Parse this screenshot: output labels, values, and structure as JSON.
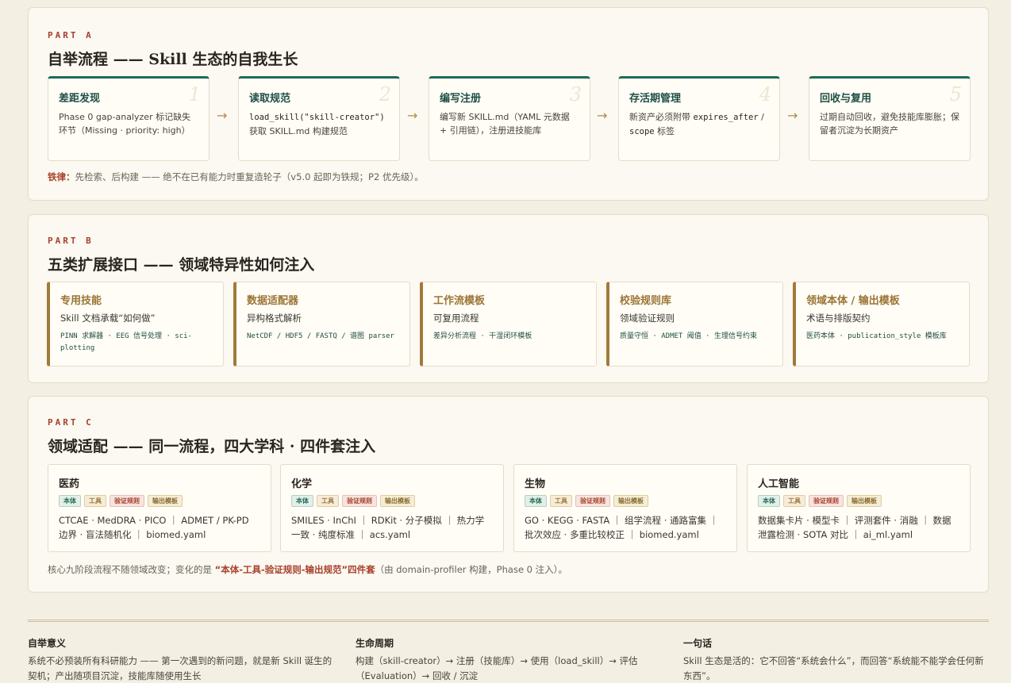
{
  "partA": {
    "label": "PART A",
    "title": "自举流程 —— Skill 生态的自我生长",
    "steps": [
      {
        "num": "1",
        "title": "差距发现",
        "desc": "Phase 0 gap-analyzer 标记缺失环节（Missing · priority: high）"
      },
      {
        "num": "2",
        "title": "读取规范",
        "code": "load_skill(\"skill-creator\")",
        "desc": " 获取 SKILL.md 构建规范"
      },
      {
        "num": "3",
        "title": "编写注册",
        "desc": "编写新 SKILL.md（YAML 元数据 + 引用链），注册进技能库"
      },
      {
        "num": "4",
        "title": "存活期管理",
        "desc1": "新资产必须附带 ",
        "code1": "expires_after",
        "desc2": " / ",
        "code2": "scope",
        "desc3": " 标签"
      },
      {
        "num": "5",
        "title": "回收与复用",
        "desc": "过期自动回收，避免技能库膨胀；保留者沉淀为长期资产"
      }
    ],
    "arrow": "→",
    "rule_label": "铁律：",
    "rule_text": "先检索、后构建 —— 绝不在已有能力时重复造轮子（v5.0 起即为铁规；P2 优先级）。"
  },
  "partB": {
    "label": "PART B",
    "title": "五类扩展接口 —— 领域特异性如何注入",
    "interfaces": [
      {
        "title": "专用技能",
        "sub": "Skill 文档承载“如何做”",
        "ex": "PINN 求解器 · EEG 信号处理 · sci-plotting"
      },
      {
        "title": "数据适配器",
        "sub": "异构格式解析",
        "ex": "NetCDF / HDF5 / FASTQ / 谱图 parser"
      },
      {
        "title": "工作流模板",
        "sub": "可复用流程",
        "ex": "差异分析流程 · 干湿闭环模板"
      },
      {
        "title": "校验规则库",
        "sub": "领域验证规则",
        "ex": "质量守恒 · ADMET 阈值 · 生理信号约束"
      },
      {
        "title": "领域本体 / 输出模板",
        "sub": "术语与排版契约",
        "ex": "医药本体 · publication_style 模板库"
      }
    ]
  },
  "partC": {
    "label": "PART C",
    "title": "领域适配 —— 同一流程，四大学科 · 四件套注入",
    "tags": [
      "本体",
      "工具",
      "验证规则",
      "输出模板"
    ],
    "domains": [
      {
        "title": "医药",
        "desc": "CTCAE · MedDRA · PICO ｜ ADMET / PK-PD 边界 · 盲法随机化 ｜ biomed.yaml"
      },
      {
        "title": "化学",
        "desc": "SMILES · InChI ｜ RDKit · 分子模拟 ｜ 热力学一致 · 纯度标准 ｜ acs.yaml"
      },
      {
        "title": "生物",
        "desc": "GO · KEGG · FASTA ｜ 组学流程 · 通路富集 ｜ 批次效应 · 多重比较校正 ｜ biomed.yaml"
      },
      {
        "title": "人工智能",
        "desc": "数据集卡片 · 模型卡 ｜ 评测套件 · 消融 ｜ 数据泄露检测 · SOTA 对比 ｜ ai_ml.yaml"
      }
    ],
    "note_pre": "核心九阶段流程不随领域改变；变化的是 ",
    "note_em": "“本体-工具-验证规则-输出规范”四件套",
    "note_post": "（由 domain-profiler 构建，Phase 0 注入）。"
  },
  "footer": [
    {
      "title": "自举意义",
      "text": "系统不必预装所有科研能力 —— 第一次遇到的新问题，就是新 Skill 诞生的契机；产出随项目沉淀，技能库随使用生长"
    },
    {
      "title": "生命周期",
      "text": "构建（skill-creator）→ 注册（技能库）→ 使用（load_skill）→ 评估（Evaluation）→ 回收 / 沉淀"
    },
    {
      "title": "一句话",
      "text": "Skill 生态是活的：它不回答“系统会什么”，而回答“系统能不能学会任何新东西”。"
    }
  ]
}
